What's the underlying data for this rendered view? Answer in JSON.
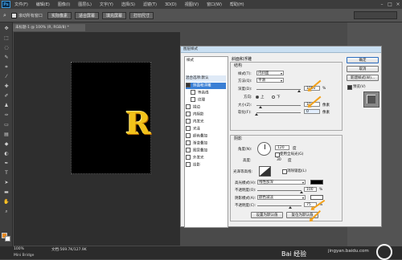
{
  "app": {
    "logo": "Ps"
  },
  "menubar": {
    "items": [
      "文件(F)",
      "编辑(E)",
      "图像(I)",
      "图层(L)",
      "文字(Y)",
      "选择(S)",
      "滤镜(T)",
      "3D(D)",
      "视图(V)",
      "窗口(W)",
      "帮助(H)"
    ]
  },
  "options": {
    "checkbox_label": "滚动所有窗口",
    "buttons": [
      "实际像素",
      "适合屏幕",
      "填充屏幕",
      "打印尺寸"
    ]
  },
  "document": {
    "tab_title": "未标题-1 @ 100% (R, RGB/8) *",
    "art_text": "R"
  },
  "status": {
    "zoom": "100%",
    "doc_size": "文档:569.7K/127.9K",
    "mini_bridge": "Mini Bridge",
    "watermark": "jingyan.baidu.com",
    "site": "Bai 经验"
  },
  "dialog": {
    "title": "图层样式",
    "styles_header": "样式",
    "blending_default": "混合选项:默认",
    "styles": [
      {
        "label": "斜面和浮雕",
        "checked": true,
        "selected": true,
        "sub": false
      },
      {
        "label": "等高线",
        "checked": false,
        "selected": false,
        "sub": true
      },
      {
        "label": "纹理",
        "checked": false,
        "selected": false,
        "sub": true
      },
      {
        "label": "描边",
        "checked": false,
        "selected": false,
        "sub": false
      },
      {
        "label": "内阴影",
        "checked": false,
        "selected": false,
        "sub": false
      },
      {
        "label": "内发光",
        "checked": false,
        "selected": false,
        "sub": false
      },
      {
        "label": "光泽",
        "checked": false,
        "selected": false,
        "sub": false
      },
      {
        "label": "颜色叠加",
        "checked": false,
        "selected": false,
        "sub": false
      },
      {
        "label": "渐变叠加",
        "checked": false,
        "selected": false,
        "sub": false
      },
      {
        "label": "图案叠加",
        "checked": false,
        "selected": false,
        "sub": false
      },
      {
        "label": "外发光",
        "checked": false,
        "selected": false,
        "sub": false
      },
      {
        "label": "投影",
        "checked": false,
        "selected": false,
        "sub": false
      }
    ],
    "bevel": {
      "section_title": "斜面和浮雕",
      "structure_title": "结构",
      "style_label": "样式(T):",
      "style_value": "内斜面",
      "technique_label": "方法(Q):",
      "technique_value": "平滑",
      "depth_label": "深度(D):",
      "depth_value": "1000",
      "depth_unit": "%",
      "direction_label": "方向:",
      "dir_up": "上",
      "dir_down": "下",
      "size_label": "大小(Z):",
      "size_value": "10",
      "size_unit": "像素",
      "soften_label": "软化(F):",
      "soften_value": "0",
      "soften_unit": "像素"
    },
    "shading": {
      "title": "阴影",
      "angle_label": "角度(N):",
      "angle_value": "120",
      "angle_unit": "度",
      "global_light": "使用全局光(G)",
      "altitude_label": "高度:",
      "altitude_value": "30",
      "altitude_unit": "度",
      "gloss_label": "光泽等高线:",
      "antialias": "消除锯齿(L)",
      "highlight_label": "高光模式(H):",
      "highlight_value": "线性加深",
      "highlight_color": "#000000",
      "highlight_opacity_label": "不透明度(O):",
      "highlight_opacity": "100",
      "shadow_label": "阴影模式(A):",
      "shadow_value": "颜色减淡",
      "shadow_color": "#ffffff",
      "shadow_opacity_label": "不透明度(C):",
      "shadow_opacity": "75",
      "percent": "%"
    },
    "make_default": "设置为默认值",
    "reset_default": "复位为默认值",
    "ok": "确定",
    "cancel": "取消",
    "new_style": "新建样式(W)...",
    "preview": "预览(V)"
  },
  "colors": {
    "accent": "#3a7fd5",
    "annotation": "#f3a11a",
    "foreground": "#e88a20"
  }
}
